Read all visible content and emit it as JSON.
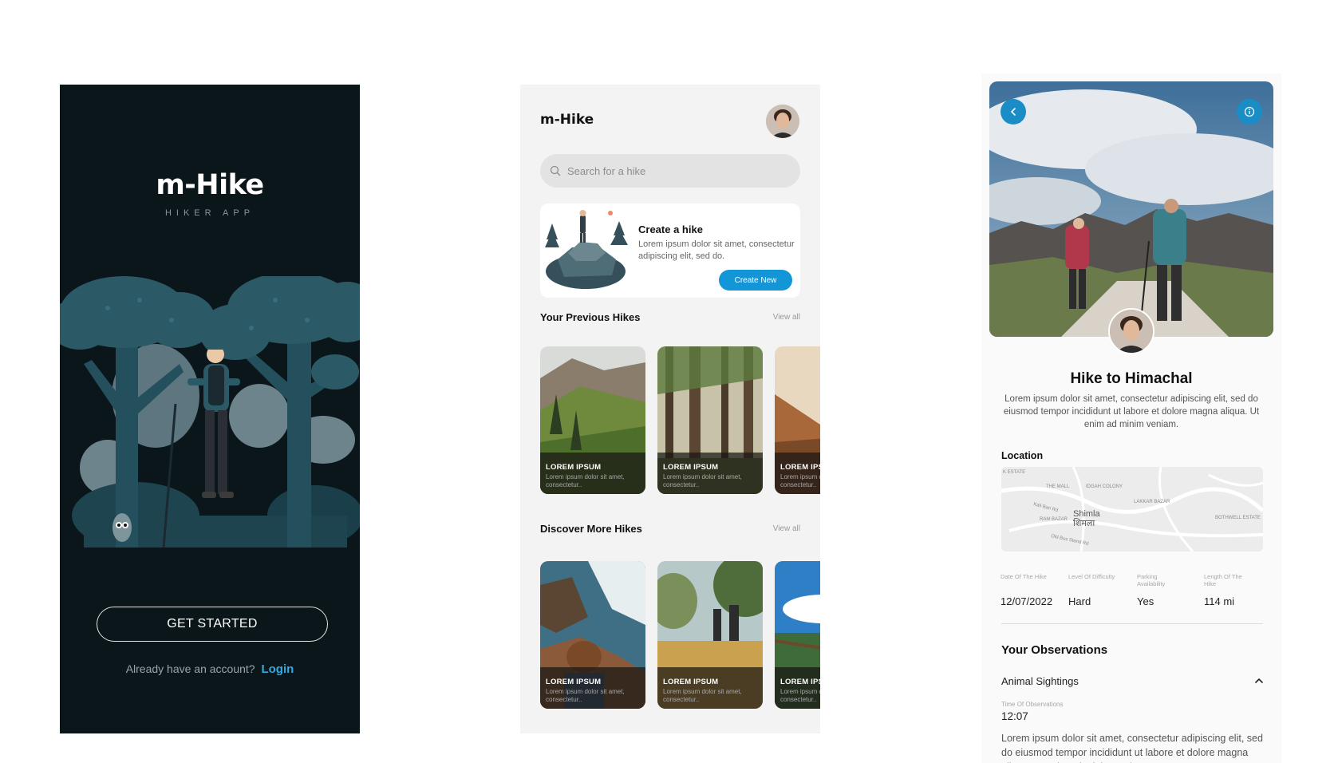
{
  "splash": {
    "logo": "m-Hike",
    "tagline": "HIKER APP",
    "get_started_label": "GET STARTED",
    "account_prompt": "Already have an account?",
    "login_label": "Login"
  },
  "home": {
    "title": "m-Hike",
    "search_placeholder": "Search for a hike",
    "create_card": {
      "title": "Create a hike",
      "description": "Lorem ipsum dolor sit amet, consectetur adipiscing elit, sed do.",
      "button_label": "Create New"
    },
    "previous": {
      "title": "Your Previous Hikes",
      "view_all": "View all",
      "cards": [
        {
          "title": "LOREM IPSUM",
          "desc": "Lorem ipsum dolor sit amet, consectetur.."
        },
        {
          "title": "LOREM IPSUM",
          "desc": "Lorem ipsum dolor sit amet, consectetur.."
        },
        {
          "title": "LOREM IPSUM",
          "desc": "Lorem ipsum dolor sit amet, consectetur.."
        }
      ]
    },
    "discover": {
      "title": "Discover More Hikes",
      "view_all": "View all",
      "cards": [
        {
          "title": "LOREM IPSUM",
          "desc": "Lorem ipsum dolor sit amet, consectetur.."
        },
        {
          "title": "LOREM IPSUM",
          "desc": "Lorem ipsum dolor sit amet, consectetur.."
        },
        {
          "title": "LOREM IPSUM",
          "desc": "Lorem ipsum dolor sit amet, consectetur.."
        }
      ]
    }
  },
  "details": {
    "title": "Hike to Himachal",
    "description": "Lorem ipsum dolor sit amet, consectetur adipiscing elit, sed do eiusmod tempor incididunt ut labore et dolore magna aliqua. Ut enim ad minim veniam.",
    "location_label": "Location",
    "map": {
      "city": "Shimla",
      "city_local": "शिमला",
      "labels": [
        "K ESTATE",
        "THE MALL",
        "IDGAH COLONY",
        "LAKKAR BAZAR",
        "RAM BAZAR",
        "BOTHWELL ESTATE",
        "Kali Bari Rd",
        "Old Bus Stand Rd"
      ]
    },
    "stats": [
      {
        "label": "Date Of The Hike",
        "value": "12/07/2022"
      },
      {
        "label": "Level Of Difficulty",
        "value": "Hard"
      },
      {
        "label": "Parking Availability",
        "value": "Yes"
      },
      {
        "label": "Length Of The Hike",
        "value": "114 mi"
      }
    ],
    "observations_title": "Your Observations",
    "observation": {
      "category": "Animal Sightings",
      "time_label": "Time Of Observations",
      "time": "12:07",
      "text": "Lorem ipsum dolor sit amet, consectetur adipiscing elit, sed do eiusmod tempor incididunt ut labore et dolore magna aliqua. Ut enim ad minim veniam."
    }
  },
  "colors": {
    "splash_bg": "#0b161a",
    "accent": "#1296d8",
    "link": "#36a9e1"
  },
  "icons": [
    "search-icon",
    "back-arrow-icon",
    "info-icon",
    "chevron-up-icon"
  ]
}
